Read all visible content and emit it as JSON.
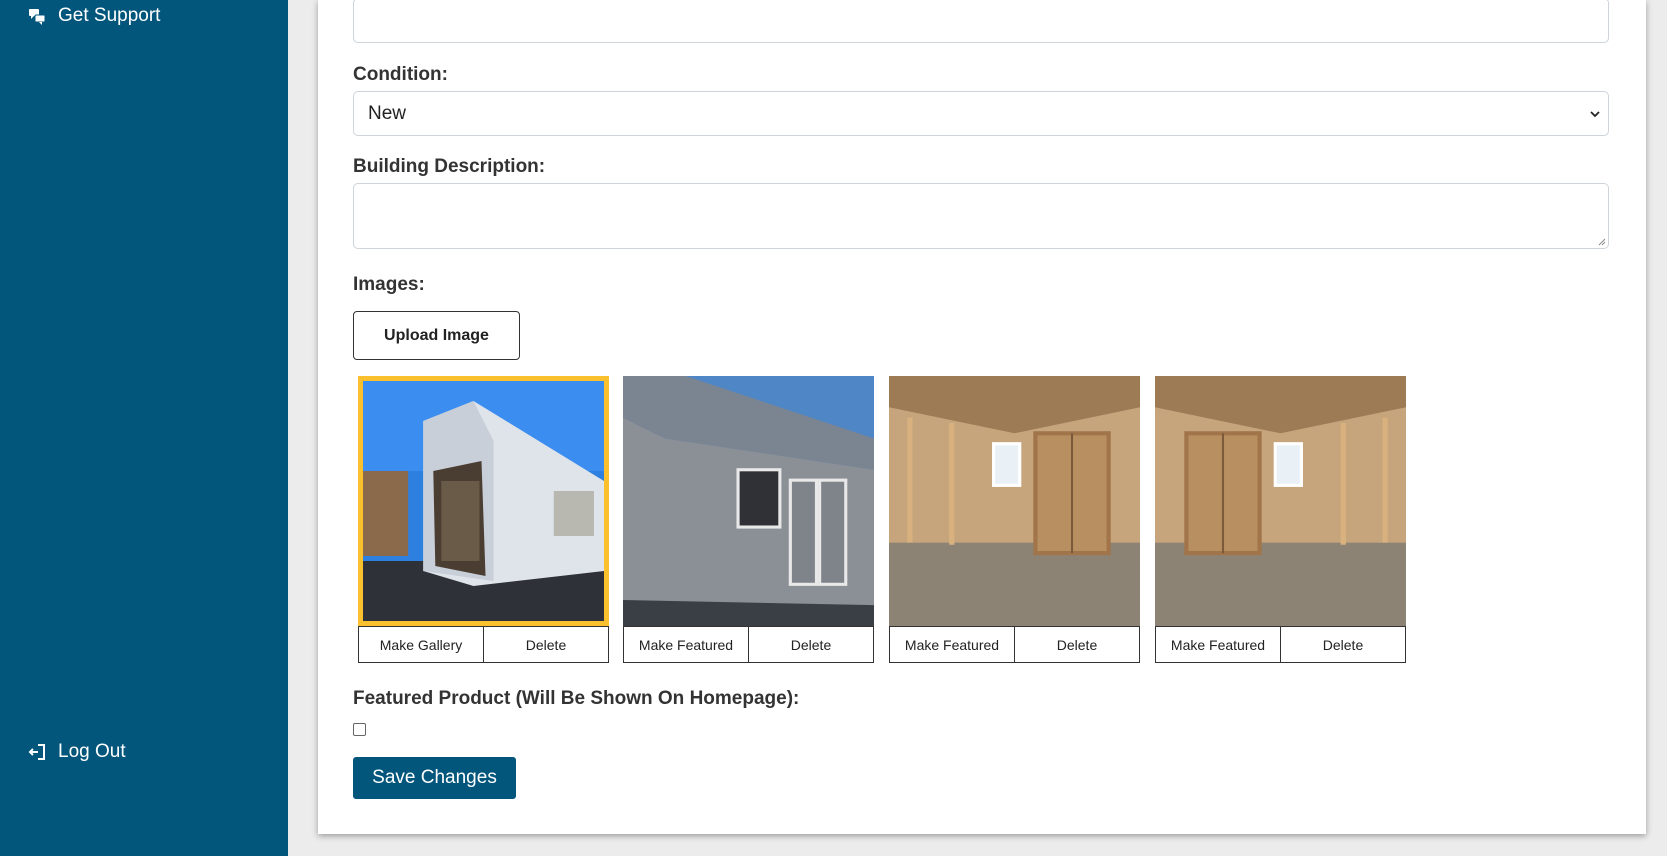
{
  "sidebar": {
    "support_label": "Get Support",
    "support_icon": "comments-icon",
    "logout_label": "Log Out",
    "logout_icon": "sign-out-icon"
  },
  "form": {
    "top_input_value": "",
    "condition_label": "Condition:",
    "condition_value": "New",
    "description_label": "Building Description:",
    "description_value": "",
    "images_label": "Images:",
    "upload_label": "Upload Image",
    "images": [
      {
        "featured": true,
        "primary_action": "Make Gallery",
        "delete_label": "Delete"
      },
      {
        "featured": false,
        "primary_action": "Make Featured",
        "delete_label": "Delete"
      },
      {
        "featured": false,
        "primary_action": "Make Featured",
        "delete_label": "Delete"
      },
      {
        "featured": false,
        "primary_action": "Make Featured",
        "delete_label": "Delete"
      }
    ],
    "featured_product_label": "Featured Product (Will Be Shown On Homepage):",
    "featured_product_checked": false,
    "save_label": "Save Changes"
  },
  "colors": {
    "sidebar_bg": "#02567b",
    "primary_button": "#02567b",
    "featured_border": "#fbc02d",
    "page_bg": "#ececec"
  }
}
